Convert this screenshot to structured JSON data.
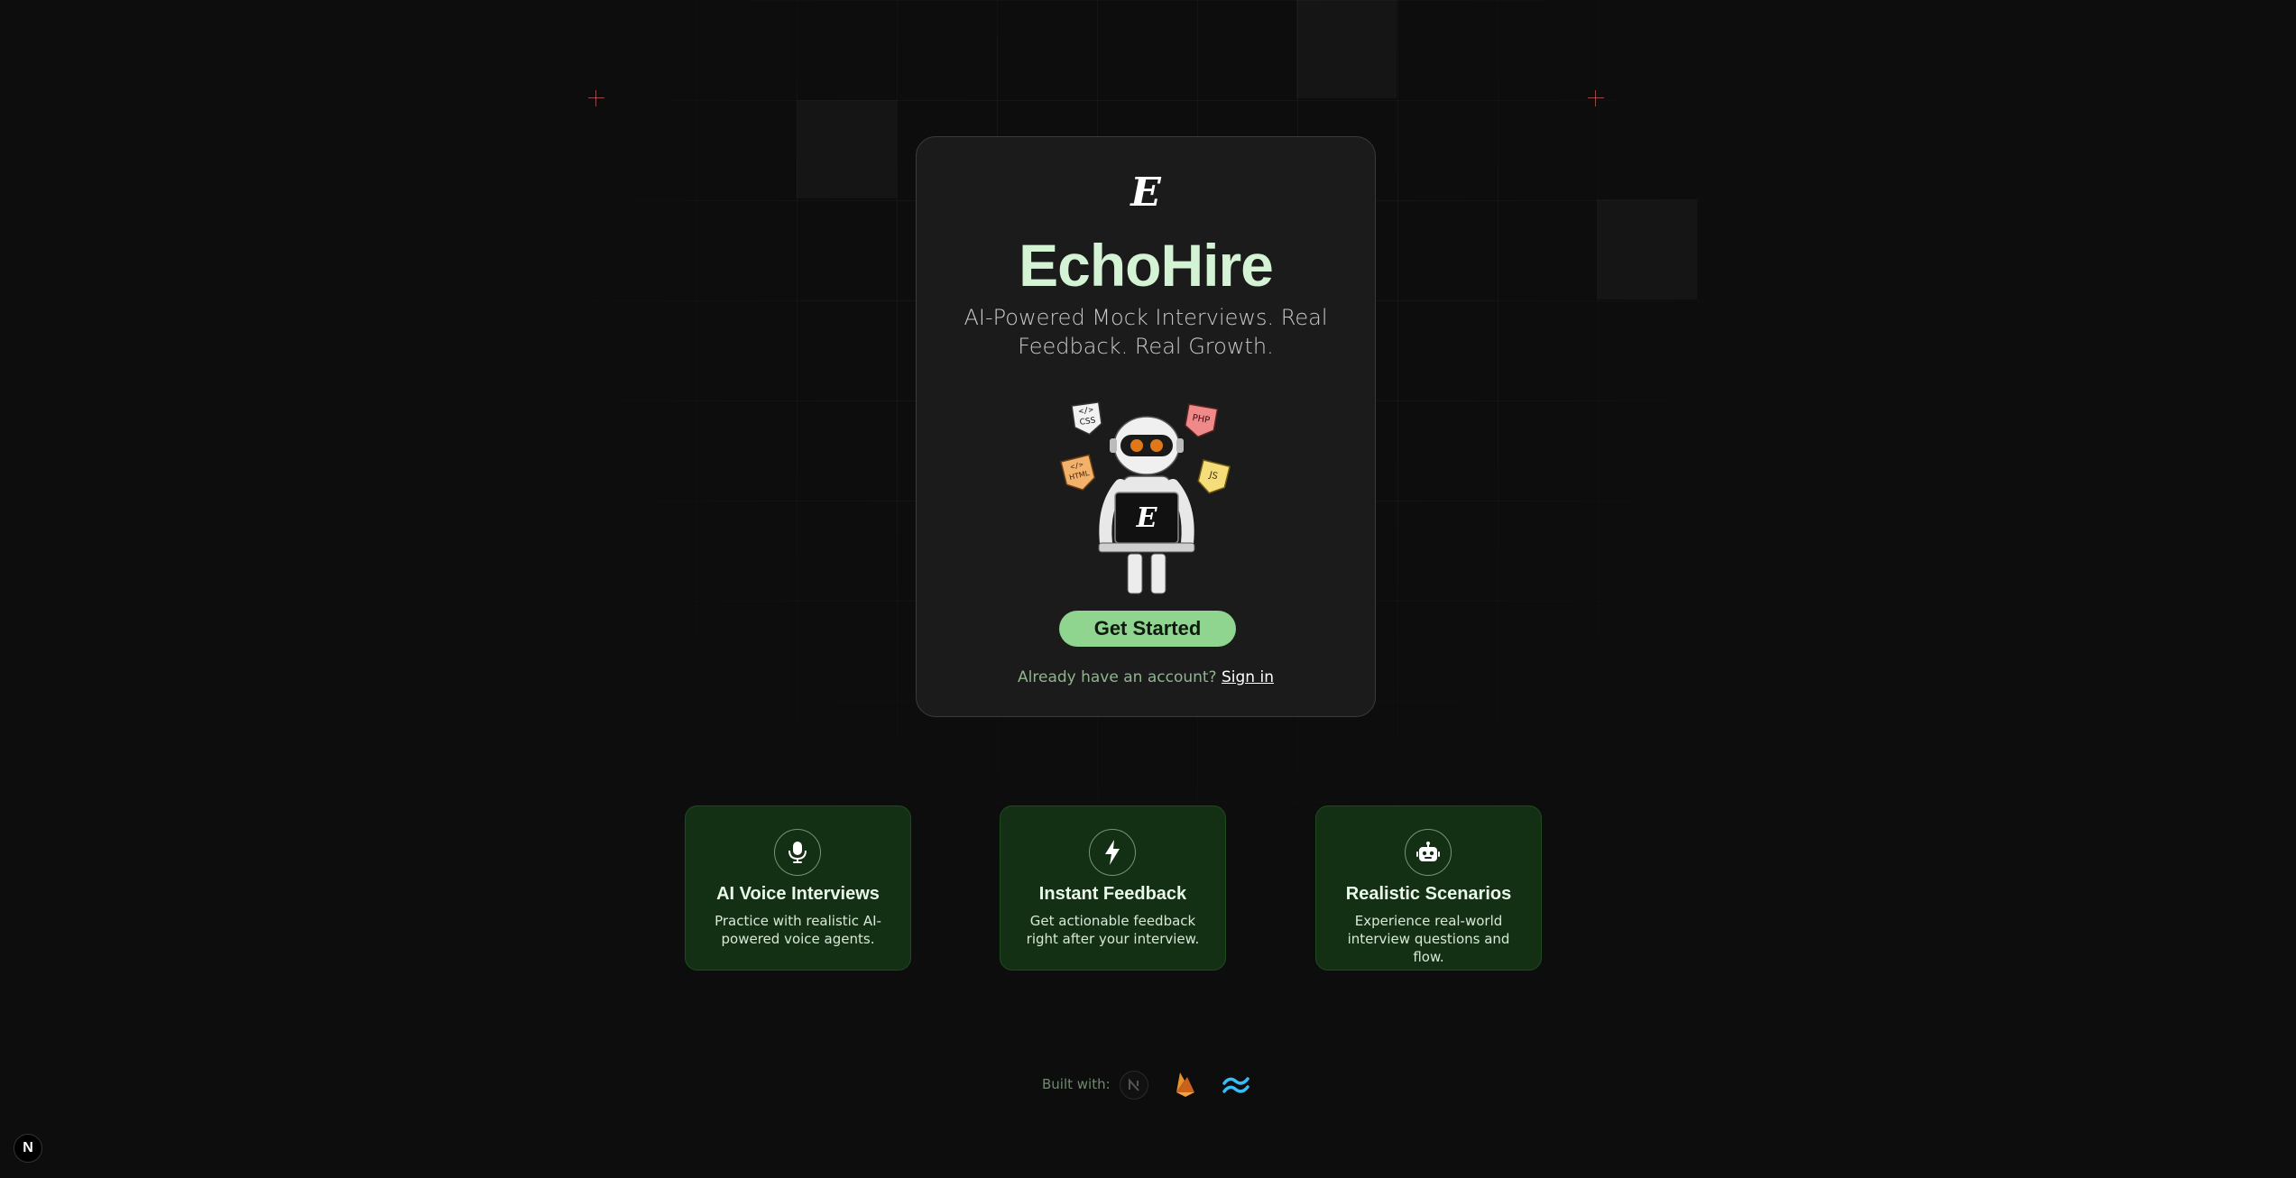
{
  "brand": {
    "logo_letter": "E",
    "name": "EchoHire"
  },
  "hero": {
    "tagline": "AI-Powered Mock Interviews. Real Feedback. Real Growth.",
    "tags": [
      "CSS",
      "PHP",
      "HTML",
      "JS"
    ],
    "laptop_letter": "E"
  },
  "cta": {
    "label": "Get Started"
  },
  "signin": {
    "prompt": "Already have an account?",
    "link": "Sign in"
  },
  "features": [
    {
      "title": "AI Voice Interviews",
      "desc": "Practice with realistic AI-powered voice agents.",
      "icon": "microphone-icon"
    },
    {
      "title": "Instant Feedback",
      "desc": "Get actionable feedback right after your interview.",
      "icon": "lightning-icon"
    },
    {
      "title": "Realistic Scenarios",
      "desc": "Experience real-world interview questions and flow.",
      "icon": "robot-icon"
    }
  ],
  "footer": {
    "built_with": "Built with:",
    "stack_icons": [
      "nextjs-icon",
      "firebase-icon",
      "tailwind-icon"
    ]
  },
  "dev_indicator": {
    "letter": "N"
  },
  "colors": {
    "accent": "#8fd48f",
    "title": "#d4f3d4",
    "feature_bg": "#143014",
    "background": "#0d0d0d"
  }
}
